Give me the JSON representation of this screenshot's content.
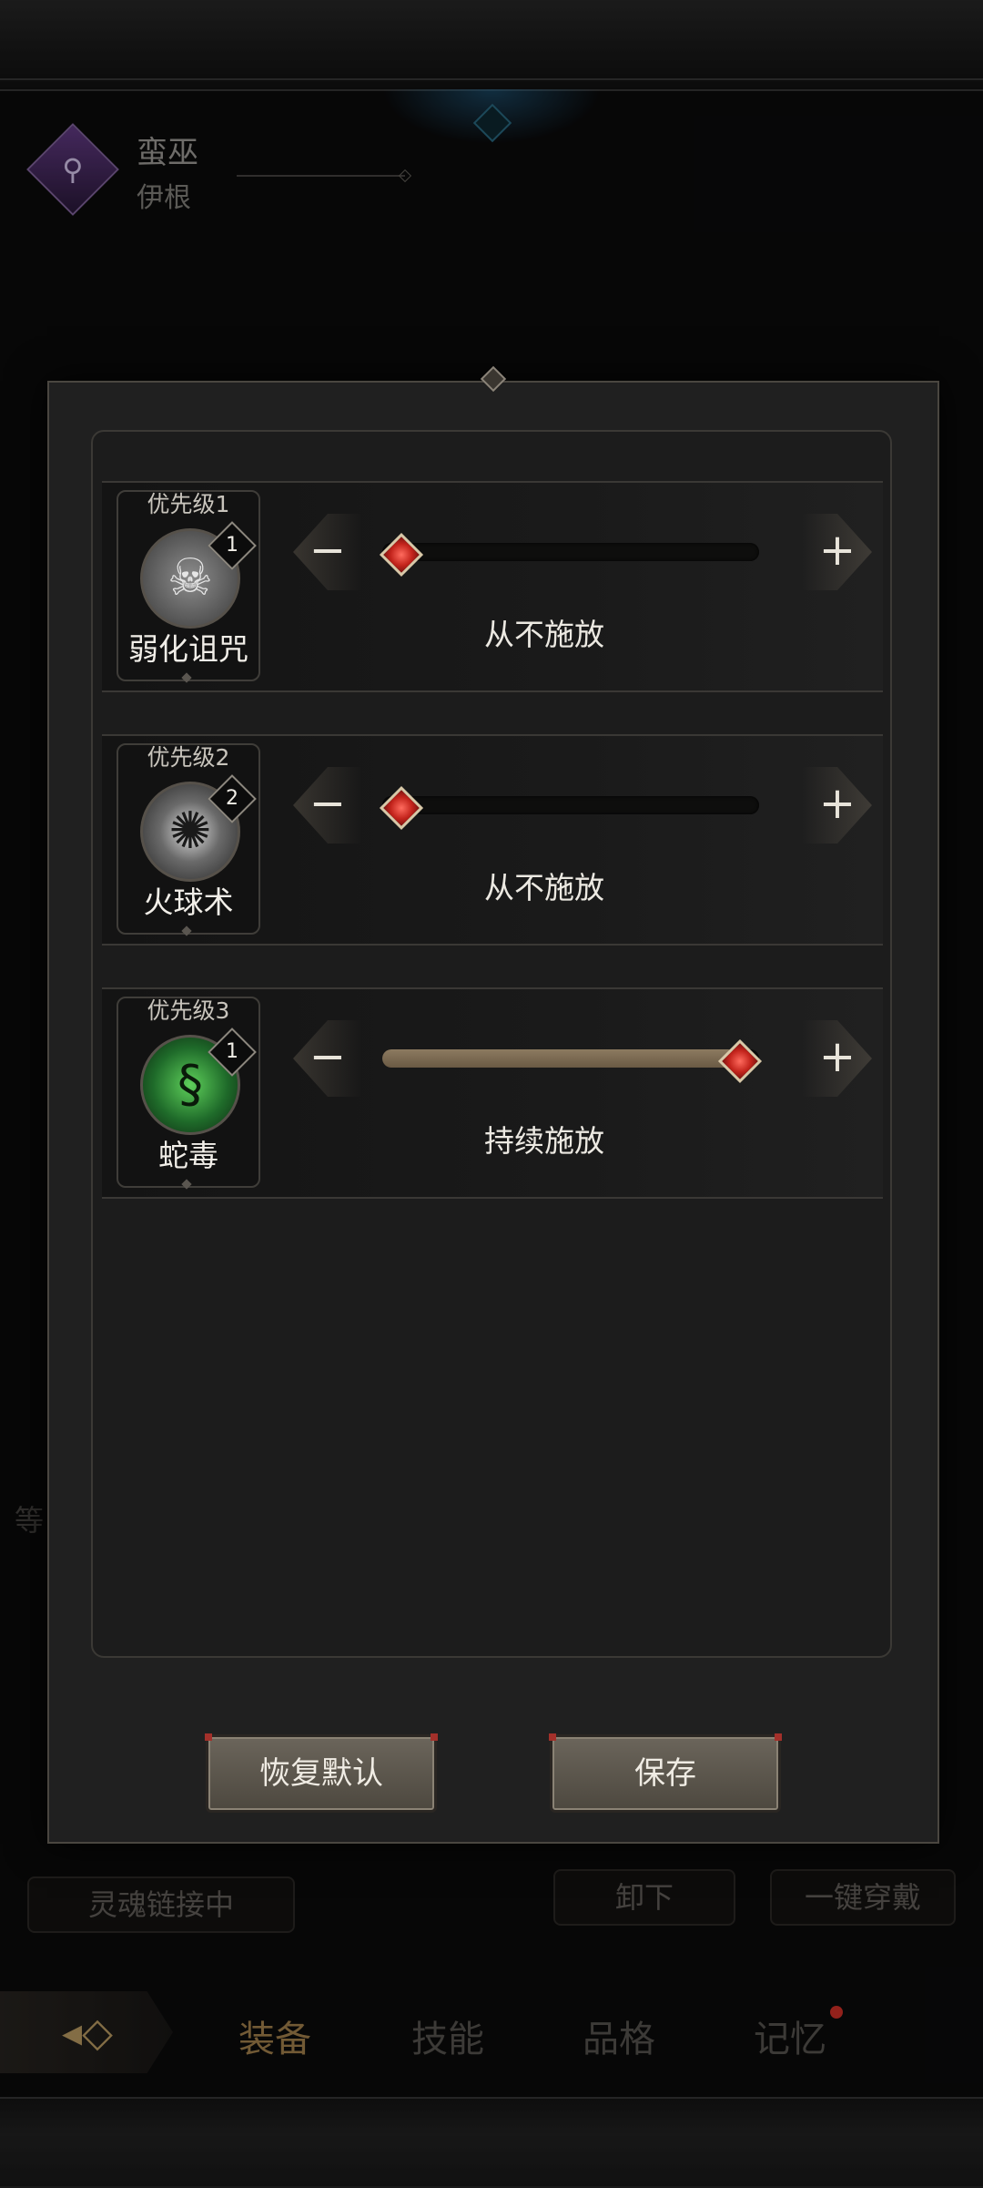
{
  "header": {
    "class_name": "蛮巫",
    "character_name": "伊根"
  },
  "background": {
    "soul_link_label": "灵魂链接中",
    "unequip_label": "卸下",
    "equip_all_label": "一键穿戴",
    "side_char": "等"
  },
  "tabs": [
    {
      "label": "装备",
      "active": true
    },
    {
      "label": "技能",
      "active": false
    },
    {
      "label": "品格",
      "active": false
    },
    {
      "label": "记忆",
      "active": false,
      "has_notification": true
    }
  ],
  "dialog": {
    "skills": [
      {
        "priority": "优先级1",
        "name": "弱化诅咒",
        "badge": "1",
        "icon": "skull-icon",
        "setting": "从不施放",
        "level": 0
      },
      {
        "priority": "优先级2",
        "name": "火球术",
        "badge": "2",
        "icon": "fireball-icon",
        "setting": "从不施放",
        "level": 0
      },
      {
        "priority": "优先级3",
        "name": "蛇毒",
        "badge": "1",
        "icon": "snake-venom-icon",
        "setting": "持续施放",
        "level": 1
      }
    ],
    "decrease_symbol": "−",
    "increase_symbol": "+",
    "reset_label": "恢复默认",
    "save_label": "保存"
  },
  "colors": {
    "accent": "#b08a52",
    "handle": "#c3241c",
    "notification": "#e0342a"
  }
}
